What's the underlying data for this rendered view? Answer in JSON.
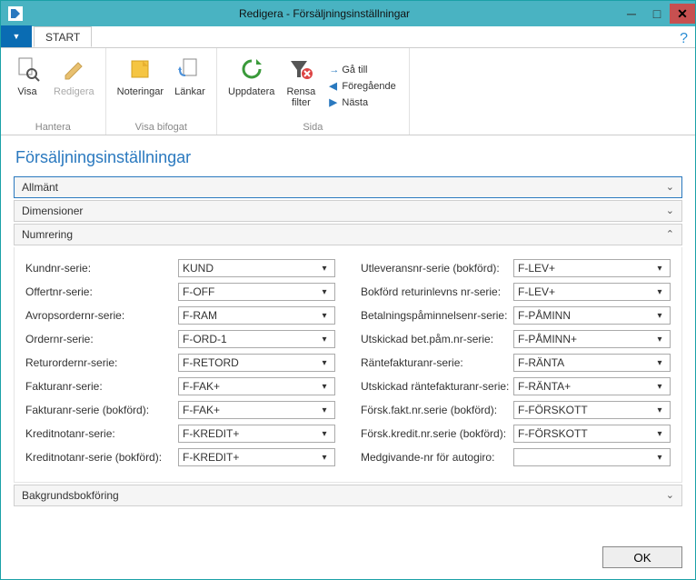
{
  "title": "Redigera - Försäljningsinställningar",
  "tabs": {
    "start": "START"
  },
  "ribbon": {
    "hantera": {
      "label": "Hantera",
      "visa": "Visa",
      "redigera": "Redigera"
    },
    "visa_bifogat": {
      "label": "Visa bifogat",
      "noteringar": "Noteringar",
      "lankar": "Länkar"
    },
    "sida": {
      "label": "Sida",
      "uppdatera": "Uppdatera",
      "rensa": "Rensa\nfilter",
      "gatill": "Gå till",
      "foregaende": "Föregående",
      "nasta": "Nästa"
    }
  },
  "page_heading": "Försäljningsinställningar",
  "sections": {
    "allmant": "Allmänt",
    "dimensioner": "Dimensioner",
    "numrering": "Numrering",
    "bakgrund": "Bakgrundsbokföring"
  },
  "fields": {
    "left": [
      {
        "label": "Kundnr-serie:",
        "value": "KUND"
      },
      {
        "label": "Offertnr-serie:",
        "value": "F-OFF"
      },
      {
        "label": "Avropsordernr-serie:",
        "value": "F-RAM"
      },
      {
        "label": "Ordernr-serie:",
        "value": "F-ORD-1"
      },
      {
        "label": "Returordernr-serie:",
        "value": "F-RETORD"
      },
      {
        "label": "Fakturanr-serie:",
        "value": "F-FAK+"
      },
      {
        "label": "Fakturanr-serie (bokförd):",
        "value": "F-FAK+"
      },
      {
        "label": "Kreditnotanr-serie:",
        "value": "F-KREDIT+"
      },
      {
        "label": "Kreditnotanr-serie (bokförd):",
        "value": "F-KREDIT+"
      }
    ],
    "right": [
      {
        "label": "Utleveransnr-serie (bokförd):",
        "value": "F-LEV+"
      },
      {
        "label": "Bokförd returinlevns nr-serie:",
        "value": "F-LEV+"
      },
      {
        "label": "Betalningspåminnelsenr-serie:",
        "value": "F-PÅMINN"
      },
      {
        "label": "Utskickad bet.påm.nr-serie:",
        "value": "F-PÅMINN+"
      },
      {
        "label": "Räntefakturanr-serie:",
        "value": "F-RÄNTA"
      },
      {
        "label": "Utskickad räntefakturanr-serie:",
        "value": "F-RÄNTA+"
      },
      {
        "label": "Försk.fakt.nr.serie (bokförd):",
        "value": "F-FÖRSKOTT"
      },
      {
        "label": "Försk.kredit.nr.serie (bokförd):",
        "value": "F-FÖRSKOTT"
      },
      {
        "label": "Medgivande-nr för autogiro:",
        "value": ""
      }
    ]
  },
  "footer": {
    "ok": "OK"
  }
}
